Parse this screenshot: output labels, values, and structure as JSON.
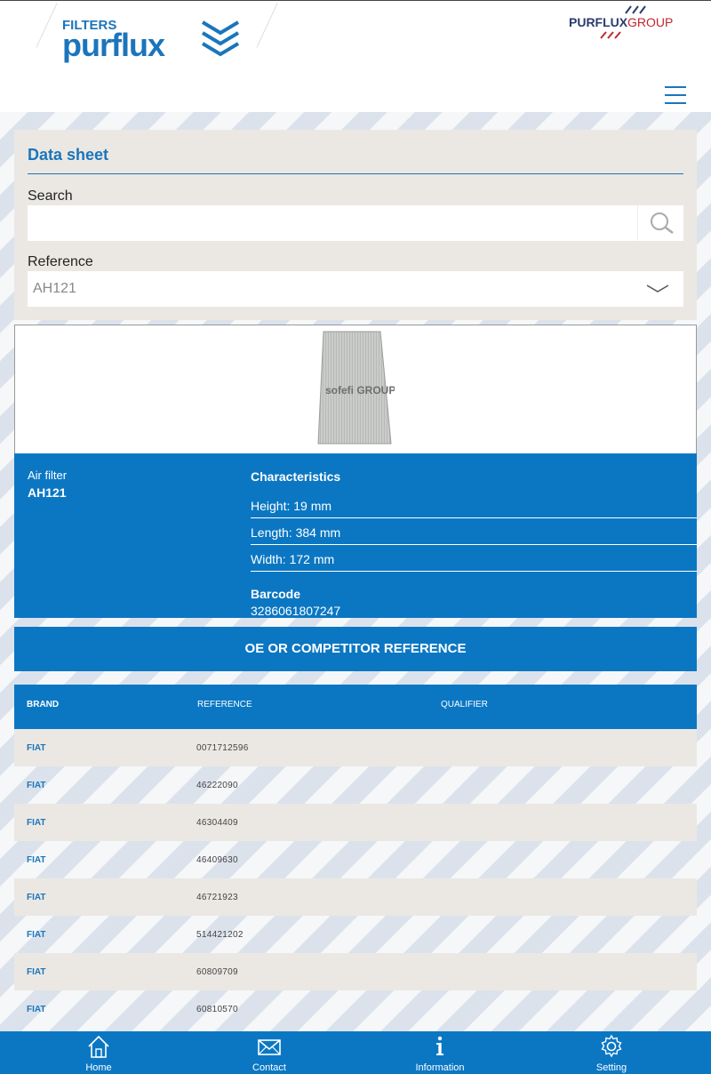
{
  "header": {
    "logo_brand": "FILTERS purflux",
    "logo_group": "PURFLUX GROUP",
    "menu_icon": "hamburger-menu-icon"
  },
  "datasheet": {
    "title": "Data sheet",
    "search_label": "Search",
    "search_value": "",
    "search_icon": "search-icon",
    "reference_label": "Reference",
    "reference_value": "AH121",
    "reference_icon": "chevron-down-icon"
  },
  "product": {
    "image_caption": "sofefi GROUP",
    "type": "Air filter",
    "reference": "AH121",
    "characteristics_title": "Characteristics",
    "characteristics": [
      "Height: 19 mm",
      "Length: 384 mm",
      "Width: 172 mm"
    ],
    "barcode_title": "Barcode",
    "barcode": "3286061807247"
  },
  "oe_section": {
    "title": "OE OR COMPETITOR REFERENCE",
    "columns": [
      "BRAND",
      "REFERENCE",
      "QUALIFIER"
    ],
    "rows": [
      {
        "brand": "FIAT",
        "reference": "0071712596",
        "qualifier": ""
      },
      {
        "brand": "FIAT",
        "reference": "46222090",
        "qualifier": ""
      },
      {
        "brand": "FIAT",
        "reference": "46304409",
        "qualifier": ""
      },
      {
        "brand": "FIAT",
        "reference": "46409630",
        "qualifier": ""
      },
      {
        "brand": "FIAT",
        "reference": "46721923",
        "qualifier": ""
      },
      {
        "brand": "FIAT",
        "reference": "514421202",
        "qualifier": ""
      },
      {
        "brand": "FIAT",
        "reference": "60809709",
        "qualifier": ""
      },
      {
        "brand": "FIAT",
        "reference": "60810570",
        "qualifier": ""
      }
    ]
  },
  "bottom_nav": {
    "items": [
      {
        "label": "Home",
        "icon": "home-icon"
      },
      {
        "label": "Contact",
        "icon": "envelope-icon"
      },
      {
        "label": "Information",
        "icon": "info-icon"
      },
      {
        "label": "Setting",
        "icon": "gear-icon"
      }
    ]
  },
  "colors": {
    "primary_blue": "#0b77c3",
    "panel_gray": "#ebe8e4"
  }
}
